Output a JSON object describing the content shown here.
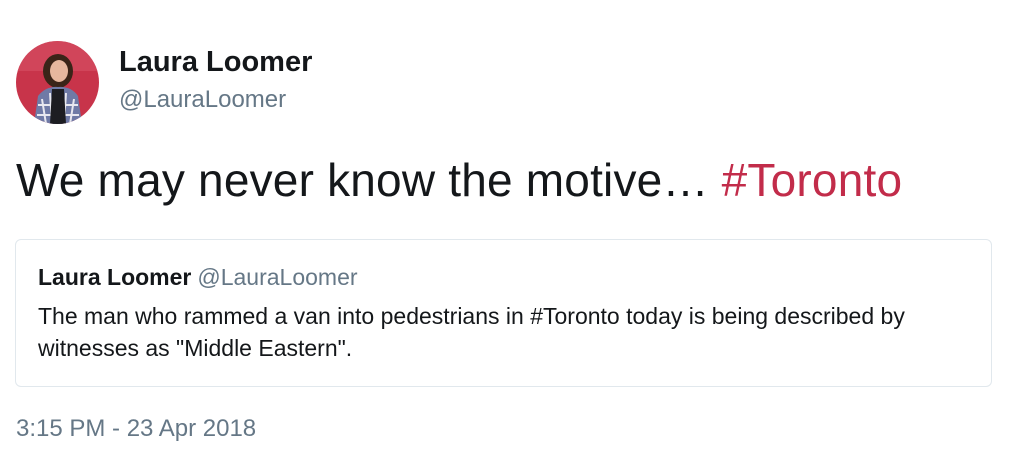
{
  "author": {
    "name": "Laura Loomer",
    "handle": "@LauraLoomer",
    "avatar_icon": "profile-photo"
  },
  "tweet": {
    "text": "We may never know the motive… ",
    "hashtag": "#Toronto"
  },
  "quoted_tweet": {
    "name": "Laura Loomer",
    "handle": "@LauraLoomer",
    "text": "The man who rammed a van into pedestrians in #Toronto today is being described by witnesses as \"Middle Eastern\"."
  },
  "timestamp": "3:15 PM - 23 Apr 2018",
  "colors": {
    "hashtag": "#c22c4a",
    "secondary_text": "#657786",
    "border": "#e1e8ed",
    "avatar_background": "#c8344a"
  }
}
